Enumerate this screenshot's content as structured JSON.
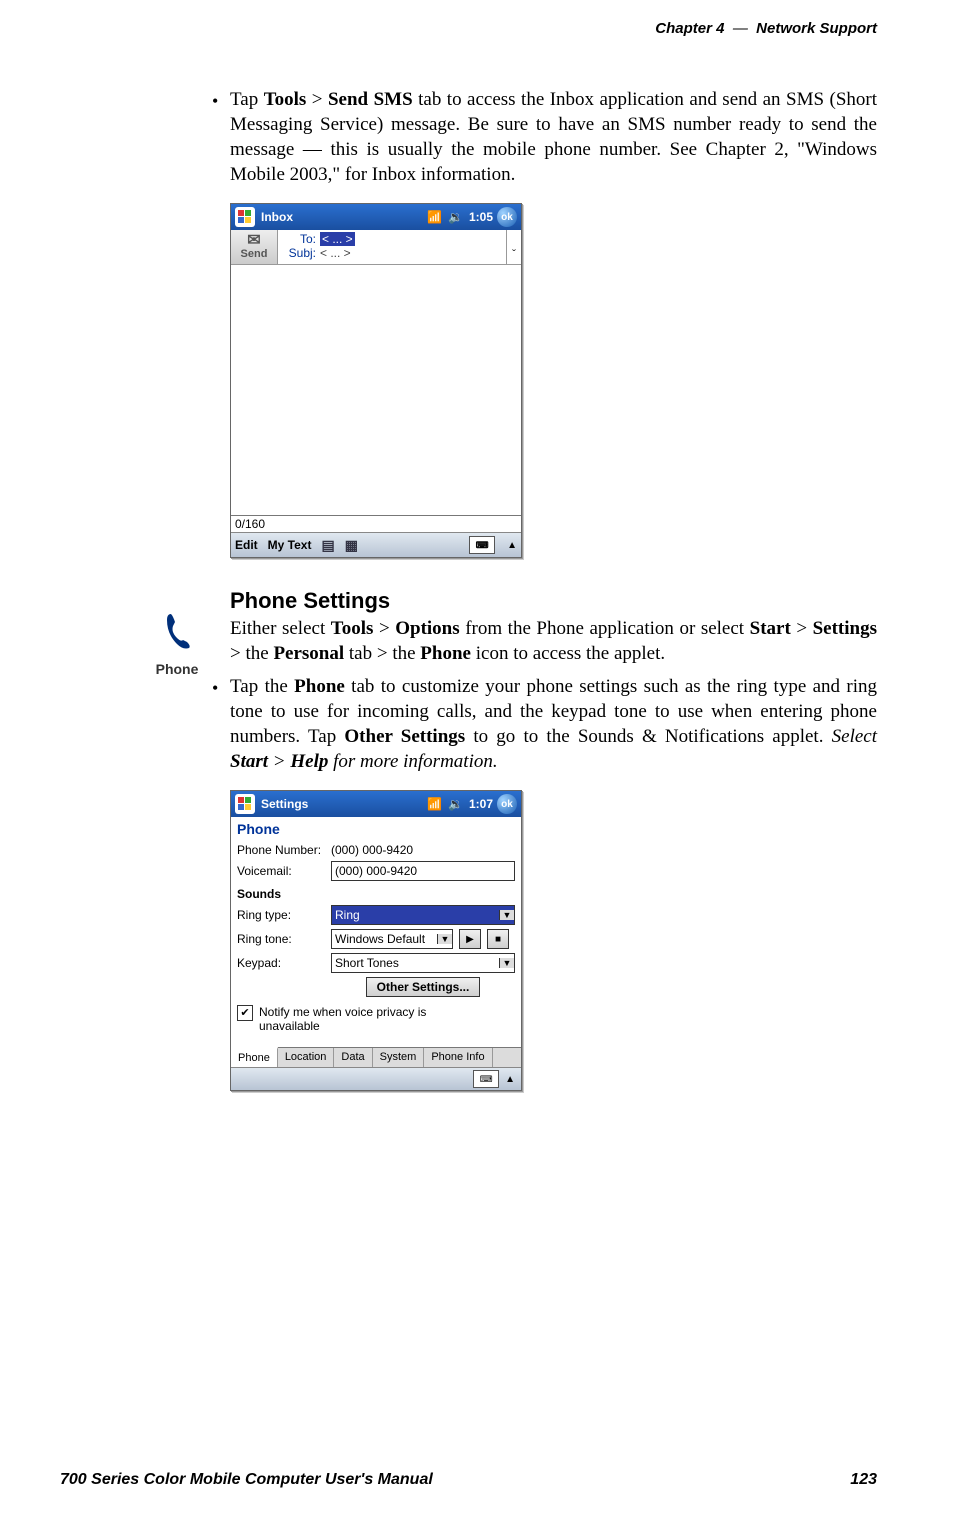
{
  "header": {
    "chapter_label": "Chapter",
    "chapter_num": "4",
    "sep": "—",
    "chapter_title": "Network Support"
  },
  "para1": {
    "pre": "Tap ",
    "b1": "Tools",
    "gt1": " > ",
    "b2": "Send SMS",
    "rest": " tab to access the Inbox application and send an SMS (Short Messaging Service) message. Be sure to have an SMS number ready to send the message — this is usually the mobile phone number. See Chapter 2, \"Windows Mobile 2003,\" for Inbox information."
  },
  "inbox": {
    "title": "Inbox",
    "time": "1:05",
    "ok": "ok",
    "send": "Send",
    "to_label": "To:",
    "to_value": "< ... >",
    "subj_label": "Subj:",
    "subj_value": "< ... >",
    "counter": "0/160",
    "menu_edit": "Edit",
    "menu_mytext": "My Text"
  },
  "phone_icon_label": "Phone",
  "h2": "Phone Settings",
  "para2": {
    "pre": "Either select ",
    "b1": "Tools",
    "gt1": " > ",
    "b2": "Options",
    "mid1": " from the Phone application or select ",
    "b3": "Start",
    "gt2": " > ",
    "b4": "Settings",
    "mid2": " > the ",
    "b5": "Personal",
    "mid3": " tab > the ",
    "b6": "Phone",
    "post": " icon to access the applet."
  },
  "para3": {
    "pre": "Tap the ",
    "b1": "Phone",
    "mid1": " tab to customize your phone settings such as the ring type and ring tone to use for incoming calls, and the keypad tone to use when entering phone numbers. Tap ",
    "b2": "Other Settings",
    "mid2": " to go to the Sounds & Notifications applet. ",
    "i1": "Select ",
    "bi1": "Start",
    "i2": " > ",
    "bi2": "Help",
    "i3": " for more information."
  },
  "settings": {
    "title": "Settings",
    "time": "1:07",
    "ok": "ok",
    "section": "Phone",
    "phone_number_label": "Phone Number:",
    "phone_number": "(000) 000-9420",
    "voicemail_label": "Voicemail:",
    "voicemail": "(000) 000-9420",
    "sounds_label": "Sounds",
    "ringtype_label": "Ring type:",
    "ringtype": "Ring",
    "ringtone_label": "Ring tone:",
    "ringtone": "Windows Default",
    "keypad_label": "Keypad:",
    "keypad": "Short Tones",
    "other_btn": "Other Settings...",
    "notify": "Notify me when voice privacy is unavailable",
    "tabs": [
      "Phone",
      "Location",
      "Data",
      "System",
      "Phone Info"
    ]
  },
  "footer": {
    "left": "700 Series Color Mobile Computer User's Manual",
    "right": "123"
  }
}
